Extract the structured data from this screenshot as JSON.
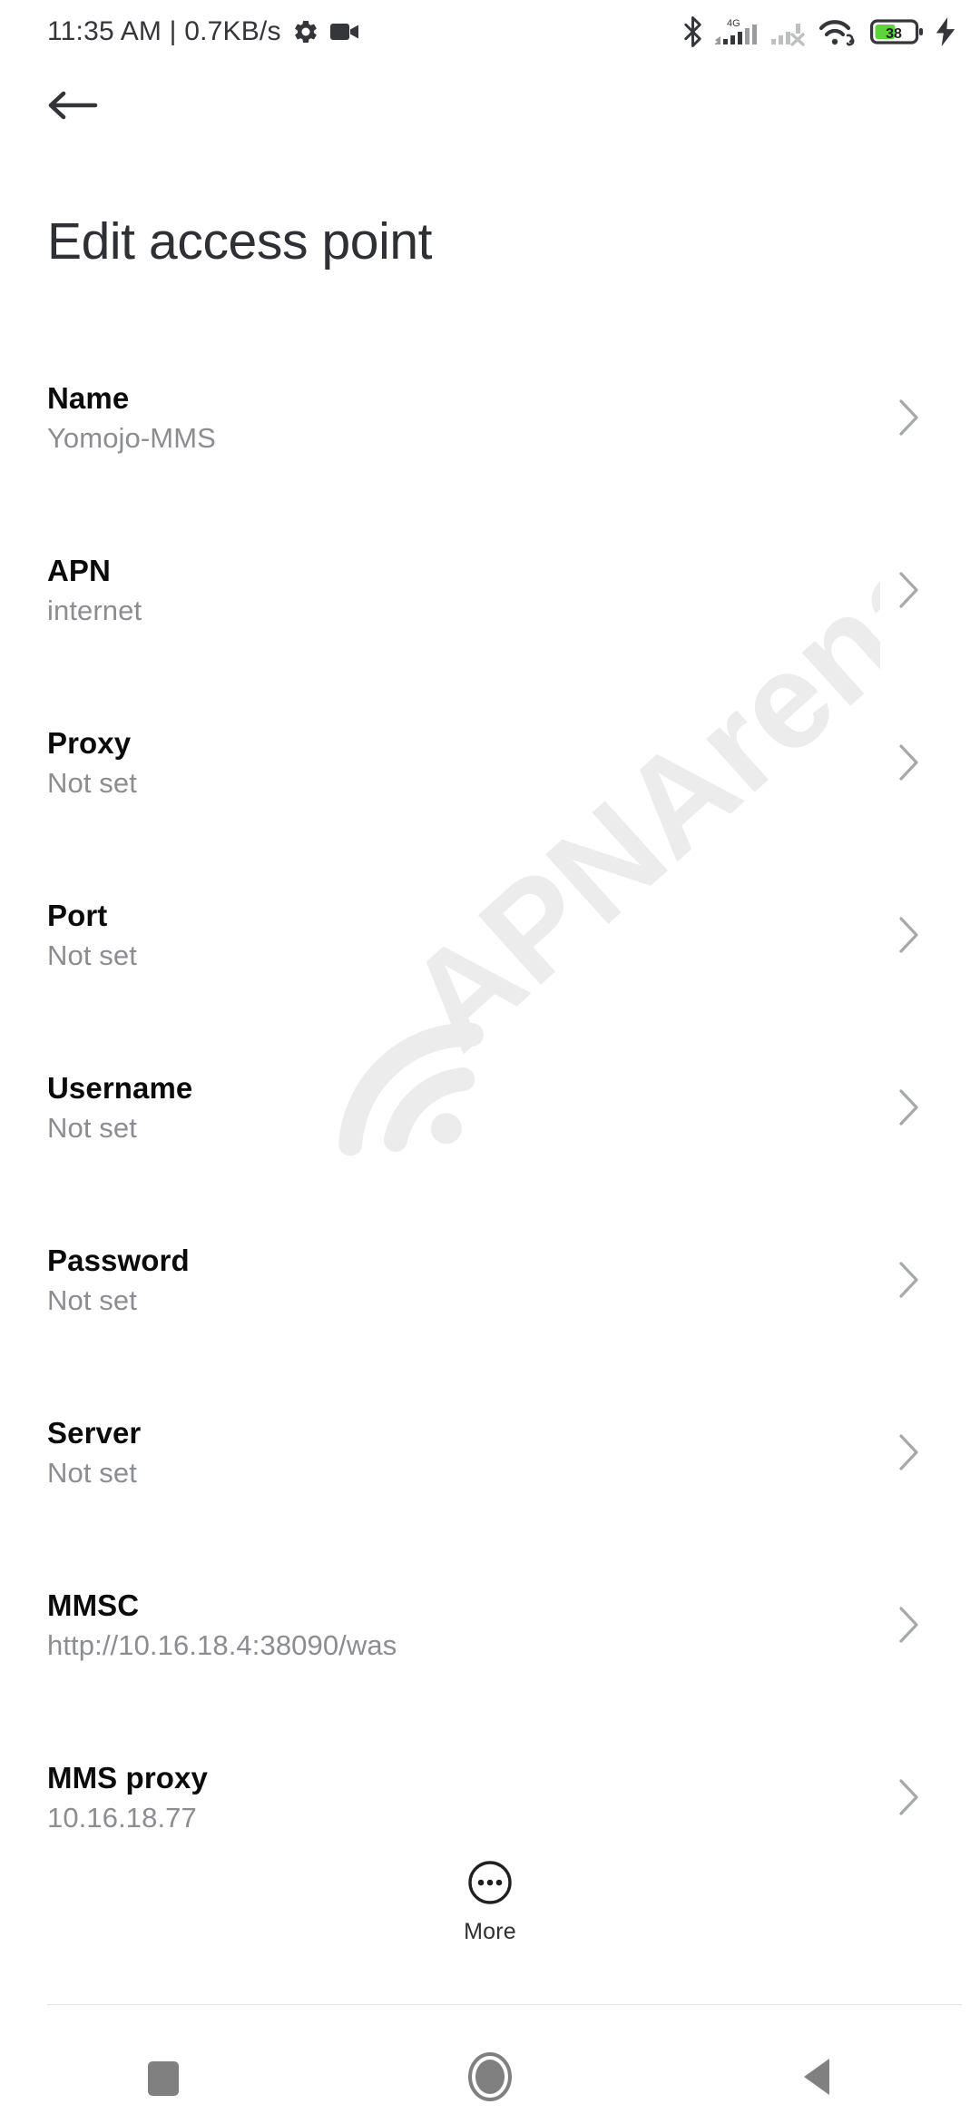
{
  "status_bar": {
    "clock": "11:35 AM | 0.7KB/s",
    "icons_left": [
      "gear-icon",
      "video-camera-icon"
    ],
    "icons_right": [
      "bluetooth-icon",
      "signal-4g-icon",
      "signal-sim2-off-icon",
      "wifi-icon",
      "battery-icon",
      "charging-bolt-icon"
    ],
    "network_label": "4G",
    "battery_percent": "38",
    "battery_fill_color": "#5FD33C",
    "icon_color": "#35363a"
  },
  "navigation": {
    "back_icon": "arrow-left-icon",
    "title": "Edit access point"
  },
  "watermark": {
    "text": "APNArena",
    "color": "#ececec"
  },
  "settings": {
    "rows": [
      {
        "title": "Name",
        "value": "Yomojo-MMS"
      },
      {
        "title": "APN",
        "value": "internet"
      },
      {
        "title": "Proxy",
        "value": "Not set"
      },
      {
        "title": "Port",
        "value": "Not set"
      },
      {
        "title": "Username",
        "value": "Not set"
      },
      {
        "title": "Password",
        "value": "Not set"
      },
      {
        "title": "Server",
        "value": "Not set"
      },
      {
        "title": "MMSC",
        "value": "http://10.16.18.4:38090/was"
      },
      {
        "title": "MMS proxy",
        "value": "10.16.18.77"
      }
    ],
    "chevron_icon": "chevron-right-icon"
  },
  "more_button": {
    "label": "More",
    "icon": "overflow-dots-circle-icon"
  },
  "system_nav": {
    "recents_icon": "square-recents-icon",
    "home_icon": "circle-home-icon",
    "back_icon": "triangle-back-icon",
    "color": "#808080"
  }
}
